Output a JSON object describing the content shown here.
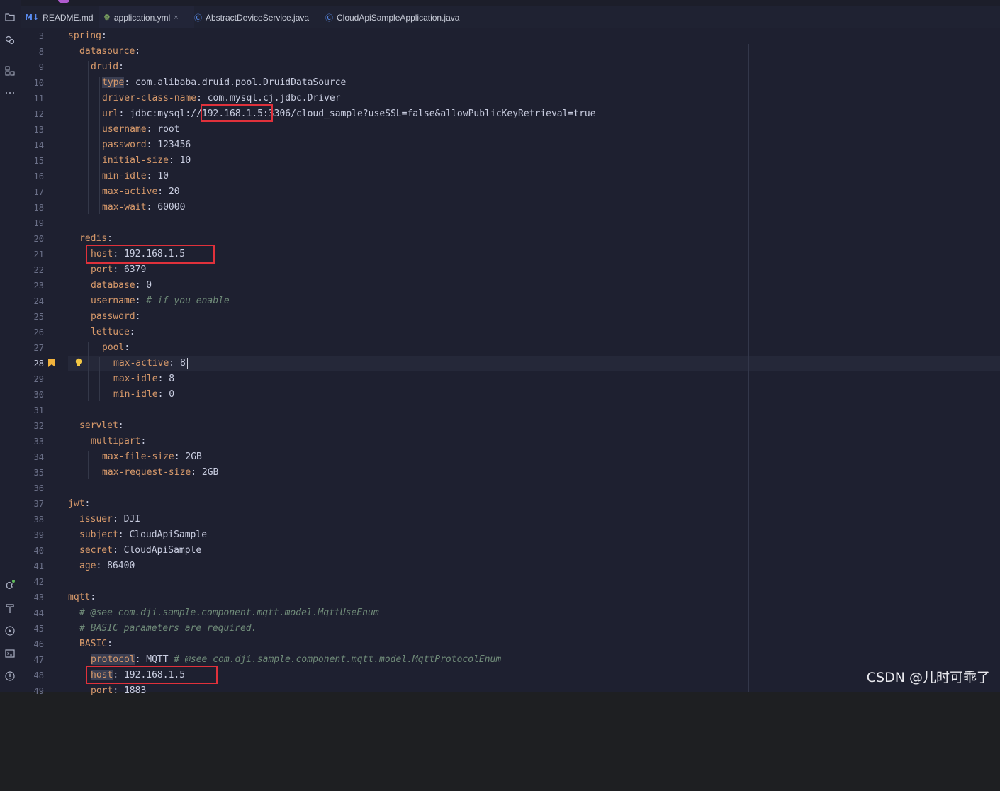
{
  "tabs": [
    {
      "icon": "M↓",
      "label": "README.md"
    },
    {
      "icon": "⚙",
      "label": "application.yml",
      "close": "×"
    },
    {
      "icon": "Ⓒ",
      "label": "AbstractDeviceService.java"
    },
    {
      "icon": "Ⓒ",
      "label": "CloudApiSampleApplication.java"
    }
  ],
  "lines": [
    {
      "n": "3",
      "ind": 0,
      "k": "spring",
      "v": ""
    },
    {
      "n": "8",
      "ind": 1,
      "k": "datasource",
      "v": ""
    },
    {
      "n": "9",
      "ind": 2,
      "k": "druid",
      "v": ""
    },
    {
      "n": "10",
      "ind": 3,
      "k": "type",
      "v": "com.alibaba.druid.pool.DruidDataSource"
    },
    {
      "n": "11",
      "ind": 3,
      "k": "driver-class-name",
      "v": "com.mysql.cj.jdbc.Driver"
    },
    {
      "n": "12",
      "ind": 3,
      "k": "url",
      "v": "jdbc:mysql://192.168.1.5:3306/cloud_sample?useSSL=false&allowPublicKeyRetrieval=true"
    },
    {
      "n": "13",
      "ind": 3,
      "k": "username",
      "v": "root"
    },
    {
      "n": "14",
      "ind": 3,
      "k": "password",
      "v": "123456"
    },
    {
      "n": "15",
      "ind": 3,
      "k": "initial-size",
      "v": "10"
    },
    {
      "n": "16",
      "ind": 3,
      "k": "min-idle",
      "v": "10"
    },
    {
      "n": "17",
      "ind": 3,
      "k": "max-active",
      "v": "20"
    },
    {
      "n": "18",
      "ind": 3,
      "k": "max-wait",
      "v": "60000"
    },
    {
      "n": "19",
      "ind": 0,
      "k": "",
      "v": ""
    },
    {
      "n": "20",
      "ind": 1,
      "k": "redis",
      "v": ""
    },
    {
      "n": "21",
      "ind": 2,
      "k": "host",
      "v": "192.168.1.5"
    },
    {
      "n": "22",
      "ind": 2,
      "k": "port",
      "v": "6379"
    },
    {
      "n": "23",
      "ind": 2,
      "k": "database",
      "v": "0"
    },
    {
      "n": "24",
      "ind": 2,
      "k": "username",
      "v": "",
      "c": "# if you enable"
    },
    {
      "n": "25",
      "ind": 2,
      "k": "password",
      "v": ""
    },
    {
      "n": "26",
      "ind": 2,
      "k": "lettuce",
      "v": ""
    },
    {
      "n": "27",
      "ind": 3,
      "k": "pool",
      "v": ""
    },
    {
      "n": "28",
      "ind": 4,
      "k": "max-active",
      "v": "8"
    },
    {
      "n": "29",
      "ind": 4,
      "k": "max-idle",
      "v": "8"
    },
    {
      "n": "30",
      "ind": 4,
      "k": "min-idle",
      "v": "0"
    },
    {
      "n": "31",
      "ind": 0,
      "k": "",
      "v": ""
    },
    {
      "n": "32",
      "ind": 1,
      "k": "servlet",
      "v": ""
    },
    {
      "n": "33",
      "ind": 2,
      "k": "multipart",
      "v": ""
    },
    {
      "n": "34",
      "ind": 3,
      "k": "max-file-size",
      "v": "2GB"
    },
    {
      "n": "35",
      "ind": 3,
      "k": "max-request-size",
      "v": "2GB"
    },
    {
      "n": "36",
      "ind": 0,
      "k": "",
      "v": ""
    },
    {
      "n": "37",
      "ind": 0,
      "k": "jwt",
      "v": ""
    },
    {
      "n": "38",
      "ind": 1,
      "k": "issuer",
      "v": "DJI"
    },
    {
      "n": "39",
      "ind": 1,
      "k": "subject",
      "v": "CloudApiSample"
    },
    {
      "n": "40",
      "ind": 1,
      "k": "secret",
      "v": "CloudApiSample"
    },
    {
      "n": "41",
      "ind": 1,
      "k": "age",
      "v": "86400"
    },
    {
      "n": "42",
      "ind": 0,
      "k": "",
      "v": ""
    },
    {
      "n": "43",
      "ind": 0,
      "k": "mqtt",
      "v": ""
    },
    {
      "n": "44",
      "ind": 1,
      "k": "",
      "v": "",
      "c": "# @see com.dji.sample.component.mqtt.model.MqttUseEnum"
    },
    {
      "n": "45",
      "ind": 1,
      "k": "",
      "v": "",
      "c": "# BASIC parameters are required."
    },
    {
      "n": "46",
      "ind": 1,
      "k": "BASIC",
      "v": ""
    },
    {
      "n": "47",
      "ind": 2,
      "k": "protocol",
      "v": "MQTT",
      "c": "# @see com.dji.sample.component.mqtt.model.MqttProtocolEnum"
    },
    {
      "n": "48",
      "ind": 2,
      "k": "host",
      "v": "192.168.1.5"
    },
    {
      "n": "49",
      "ind": 2,
      "k": "port",
      "v": "1883"
    }
  ],
  "current_line": "28",
  "watermark": "CSDN @儿时可乖了"
}
